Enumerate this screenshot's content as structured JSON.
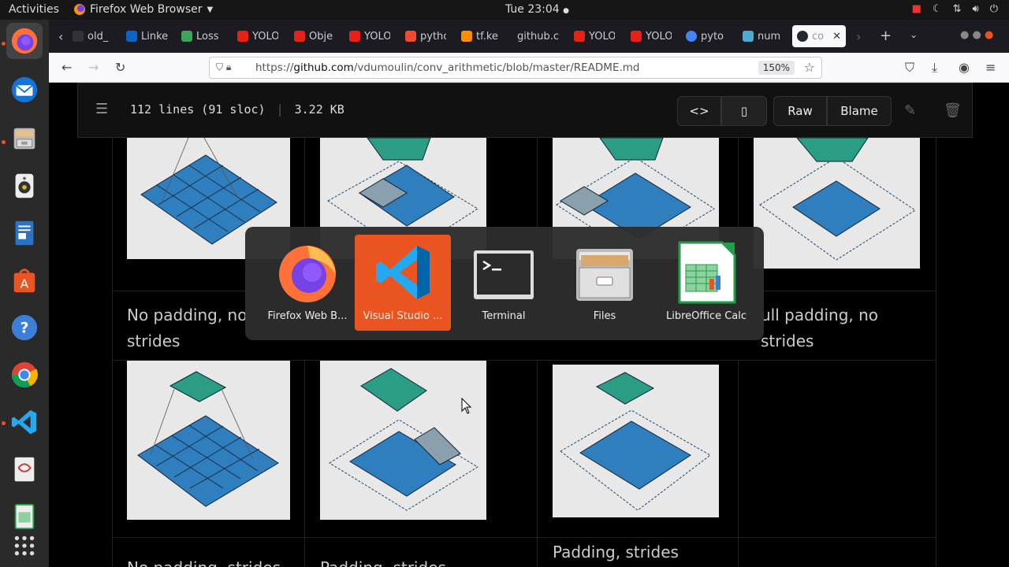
{
  "topbar": {
    "activities": "Activities",
    "app_menu": "Firefox Web Browser",
    "clock": "Tue 23:04"
  },
  "browser": {
    "tabs": [
      {
        "label": "old_",
        "icon_color": "#333"
      },
      {
        "label": "Linke",
        "icon_color": "#0a66c2"
      },
      {
        "label": "Loss",
        "icon_color": "#3ba55c"
      },
      {
        "label": "YOLO",
        "icon_color": "#e62117"
      },
      {
        "label": "Obje",
        "icon_color": "#e62117"
      },
      {
        "label": "YOLO",
        "icon_color": "#e62117"
      },
      {
        "label": "pytho",
        "icon_color": "#ee4c2c"
      },
      {
        "label": "tf.ke",
        "icon_color": "#ff8f00"
      },
      {
        "label": "github.c",
        "icon_color": "#1c1b22"
      },
      {
        "label": "YOLO",
        "icon_color": "#e62117"
      },
      {
        "label": "YOLO",
        "icon_color": "#e62117"
      },
      {
        "label": "pyto",
        "icon_color": "#4285f4"
      },
      {
        "label": "num",
        "icon_color": "#4dabcf"
      },
      {
        "label": "co",
        "icon_color": "#24292f"
      }
    ],
    "url_domain": "github.com",
    "url_prefix": "https://",
    "url_path": "/vdumoulin/conv_arithmetic/blob/master/README.md",
    "zoom": "150%"
  },
  "file_header": {
    "lines": "112 lines (91 sloc)",
    "size": "3.22 KB",
    "raw_label": "Raw",
    "blame_label": "Blame"
  },
  "captions": {
    "row1_col1": "No padding, no strides",
    "row1_col4": "Full padding, no strides",
    "row1_col4_visible": "ull padding, no strides",
    "row2_col1": "No padding, strides",
    "row2_col2": "Padding, strides",
    "row2_col3": "Padding, strides"
  },
  "app_switcher": {
    "items": [
      {
        "label": "Firefox Web B...",
        "icon": "firefox-icon",
        "selected": false
      },
      {
        "label": "Visual Studio ...",
        "icon": "vscode-icon",
        "selected": true
      },
      {
        "label": "Terminal",
        "icon": "terminal-icon",
        "selected": false
      },
      {
        "label": "Files",
        "icon": "files-icon",
        "selected": false
      },
      {
        "label": "LibreOffice Calc",
        "icon": "calc-icon",
        "selected": false
      }
    ]
  },
  "colors": {
    "accent": "#e95420",
    "grid_blue": "#2f7fbf",
    "grid_teal": "#2a9d84"
  }
}
